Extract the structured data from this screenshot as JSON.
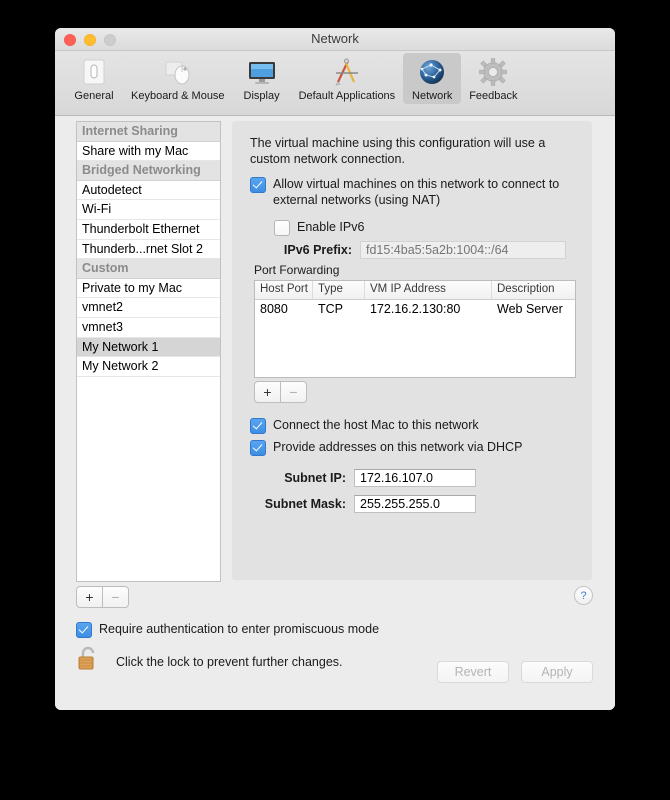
{
  "window": {
    "title": "Network",
    "traffic_lights": [
      "close",
      "minimize",
      "zoom"
    ]
  },
  "toolbar": {
    "items": [
      {
        "label": "General",
        "icon": "general-icon",
        "selected": false
      },
      {
        "label": "Keyboard & Mouse",
        "icon": "keyboard-mouse-icon",
        "selected": false
      },
      {
        "label": "Display",
        "icon": "display-icon",
        "selected": false
      },
      {
        "label": "Default Applications",
        "icon": "default-applications-icon",
        "selected": false
      },
      {
        "label": "Network",
        "icon": "network-globe-icon",
        "selected": true
      },
      {
        "label": "Feedback",
        "icon": "feedback-gear-icon",
        "selected": false
      }
    ]
  },
  "sidebar": {
    "items": [
      {
        "label": "Internet Sharing",
        "type": "header",
        "selected": false
      },
      {
        "label": "Share with my Mac",
        "type": "item",
        "selected": false
      },
      {
        "label": "Bridged Networking",
        "type": "header",
        "selected": false
      },
      {
        "label": "Autodetect",
        "type": "item",
        "selected": false
      },
      {
        "label": "Wi-Fi",
        "type": "item",
        "selected": false
      },
      {
        "label": "Thunderbolt Ethernet",
        "type": "item",
        "selected": false
      },
      {
        "label": "Thunderb...rnet Slot 2",
        "type": "item",
        "selected": false
      },
      {
        "label": "Custom",
        "type": "header",
        "selected": false
      },
      {
        "label": "Private to my Mac",
        "type": "item",
        "selected": false
      },
      {
        "label": "vmnet2",
        "type": "item",
        "selected": false
      },
      {
        "label": "vmnet3",
        "type": "item",
        "selected": false
      },
      {
        "label": "My Network 1",
        "type": "item",
        "selected": true
      },
      {
        "label": "My Network 2",
        "type": "item",
        "selected": false
      }
    ],
    "add_label": "+",
    "remove_label": "−"
  },
  "detail": {
    "description": "The virtual machine using this configuration will use a custom network connection.",
    "allow_nat": {
      "label": "Allow virtual machines on this network to connect to external networks (using NAT)",
      "checked": true
    },
    "enable_ipv6": {
      "label": "Enable IPv6",
      "checked": false
    },
    "ipv6_prefix": {
      "label": "IPv6 Prefix:",
      "value": "",
      "placeholder": "fd15:4ba5:5a2b:1004::/64",
      "disabled": true
    },
    "port_forwarding": {
      "title": "Port Forwarding",
      "columns": [
        "Host Port",
        "Type",
        "VM IP Address",
        "Description"
      ],
      "rows": [
        [
          "8080",
          "TCP",
          "172.16.2.130:80",
          "Web Server"
        ]
      ],
      "add_label": "+",
      "remove_label": "−"
    },
    "connect_host": {
      "label": "Connect the host Mac to this network",
      "checked": true
    },
    "dhcp": {
      "label": "Provide addresses on this network via DHCP",
      "checked": true
    },
    "subnet_ip": {
      "label": "Subnet IP:",
      "value": "172.16.107.0"
    },
    "subnet_mask": {
      "label": "Subnet Mask:",
      "value": "255.255.255.0"
    }
  },
  "footer": {
    "help_label": "?",
    "promiscuous": {
      "label": "Require authentication to enter promiscuous mode",
      "checked": true
    },
    "lock_text": "Click the lock to prevent further changes.",
    "lock_state": "unlocked",
    "revert_label": "Revert",
    "apply_label": "Apply"
  },
  "colors": {
    "accent_checkbox": "#3d8ee4",
    "selection": "#d5d5d5",
    "panel_bg": "#e2e2e2",
    "window_bg": "#ececec",
    "help_blue": "#3c7fd4",
    "lock_orange": "#d79440"
  }
}
